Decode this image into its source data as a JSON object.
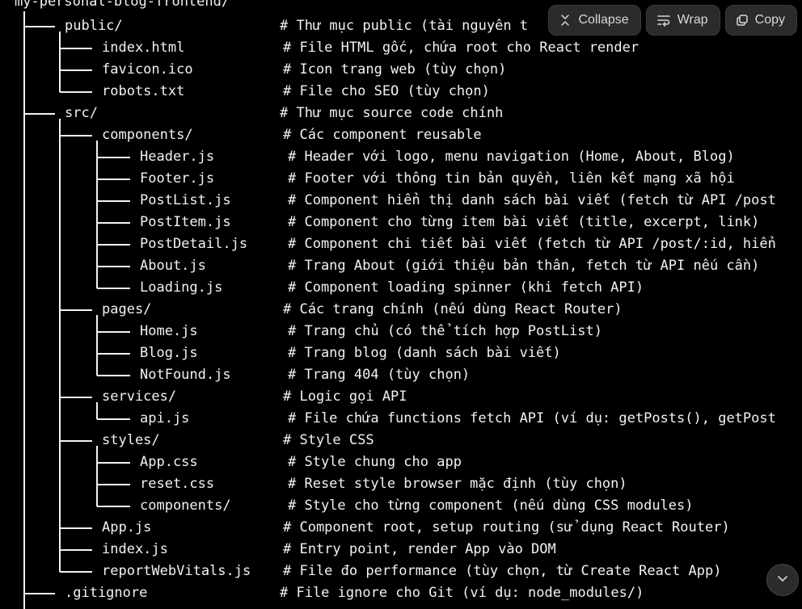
{
  "root_title": "my-personal-blog-frontend/",
  "toolbar": {
    "collapse_label": "Collapse",
    "wrap_label": "Wrap",
    "copy_label": "Copy"
  },
  "tree": [
    {
      "depth": 0,
      "name": "public/",
      "comment": "# Thư mục public (tài nguyên t"
    },
    {
      "depth": 1,
      "name": "index.html",
      "comment": "# File HTML gốc, chứa root cho React render"
    },
    {
      "depth": 1,
      "name": "favicon.ico",
      "comment": "# Icon trang web (tùy chọn)"
    },
    {
      "depth": 1,
      "name": "robots.txt",
      "comment": "# File cho SEO (tùy chọn)"
    },
    {
      "depth": 0,
      "name": "src/",
      "comment": "# Thư mục source code chính"
    },
    {
      "depth": 1,
      "name": "components/",
      "comment": "# Các component reusable"
    },
    {
      "depth": 2,
      "name": "Header.js",
      "comment": "# Header với logo, menu navigation (Home, About, Blog)"
    },
    {
      "depth": 2,
      "name": "Footer.js",
      "comment": "# Footer với thông tin bản quyền, liên kết mạng xã hội"
    },
    {
      "depth": 2,
      "name": "PostList.js",
      "comment": "# Component hiển thị danh sách bài viết (fetch từ API /post"
    },
    {
      "depth": 2,
      "name": "PostItem.js",
      "comment": "# Component cho từng item bài viết (title, excerpt, link)"
    },
    {
      "depth": 2,
      "name": "PostDetail.js",
      "comment": "# Component chi tiết bài viết (fetch từ API /post/:id, hiển"
    },
    {
      "depth": 2,
      "name": "About.js",
      "comment": "# Trang About (giới thiệu bản thân, fetch từ API nếu cần)"
    },
    {
      "depth": 2,
      "name": "Loading.js",
      "comment": "# Component loading spinner (khi fetch API)"
    },
    {
      "depth": 1,
      "name": "pages/",
      "comment": "# Các trang chính (nếu dùng React Router)"
    },
    {
      "depth": 2,
      "name": "Home.js",
      "comment": "# Trang chủ (có thể tích hợp PostList)"
    },
    {
      "depth": 2,
      "name": "Blog.js",
      "comment": "# Trang blog (danh sách bài viết)"
    },
    {
      "depth": 2,
      "name": "NotFound.js",
      "comment": "# Trang 404 (tùy chọn)"
    },
    {
      "depth": 1,
      "name": "services/",
      "comment": "# Logic gọi API"
    },
    {
      "depth": 2,
      "name": "api.js",
      "comment": "# File chứa functions fetch API (ví dụ: getPosts(), getPost"
    },
    {
      "depth": 1,
      "name": "styles/",
      "comment": "# Style CSS"
    },
    {
      "depth": 2,
      "name": "App.css",
      "comment": "# Style chung cho app"
    },
    {
      "depth": 2,
      "name": "reset.css",
      "comment": "# Reset style browser mặc định (tùy chọn)"
    },
    {
      "depth": 2,
      "name": "components/",
      "comment": "# Style cho từng component (nếu dùng CSS modules)"
    },
    {
      "depth": 1,
      "name": "App.js",
      "comment": "# Component root, setup routing (sử dụng React Router)"
    },
    {
      "depth": 1,
      "name": "index.js",
      "comment": "# Entry point, render App vào DOM"
    },
    {
      "depth": 1,
      "name": "reportWebVitals.js",
      "comment": "# File đo performance (tùy chọn, từ Create React App)"
    },
    {
      "depth": 0,
      "name": ".gitignore",
      "comment": "# File ignore cho Git (ví dụ: node_modules/)"
    }
  ],
  "icons": {
    "collapse": "collapse-icon",
    "wrap": "wrap-icon",
    "copy": "copy-icon",
    "scroll_down": "chevron-down-icon"
  }
}
